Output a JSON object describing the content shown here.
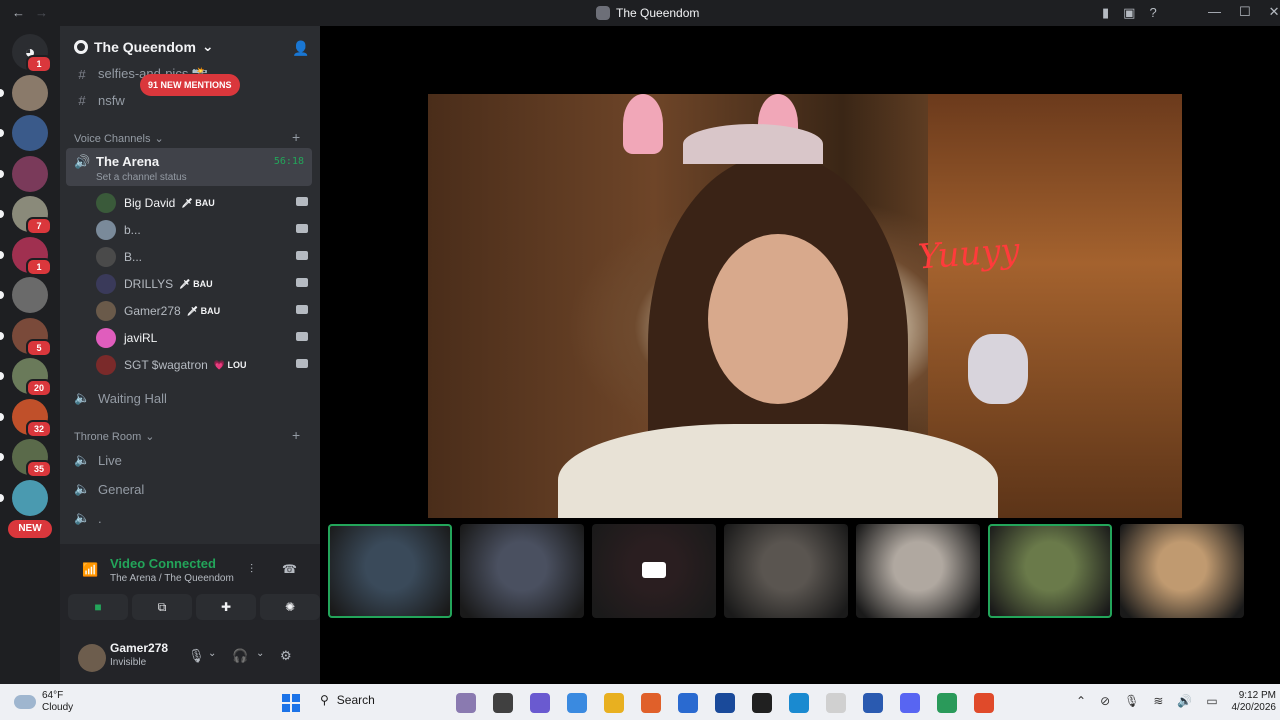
{
  "window": {
    "title": "The Queendom",
    "back": "←",
    "forward": "→",
    "minimize": "—",
    "maximize": "☐",
    "close": "✕"
  },
  "guilds": [
    {
      "name": "home",
      "badge": "1",
      "color": "#2b2d31"
    },
    {
      "badge": "",
      "color": "#8a7a6a"
    },
    {
      "badge": "",
      "color": "#3a5a8a"
    },
    {
      "badge": "",
      "color": "#7a3a5a"
    },
    {
      "badge": "7",
      "color": "#8a8a7a"
    },
    {
      "badge": "1",
      "color": "#a03050"
    },
    {
      "badge": "",
      "color": "#6a6a6a"
    },
    {
      "badge": "5",
      "color": "#7a4a3a"
    },
    {
      "badge": "20",
      "color": "#6a7a5a"
    },
    {
      "badge": "32",
      "color": "#c0502a"
    },
    {
      "badge": "35",
      "color": "#5a6a4a"
    },
    {
      "badge": "",
      "color": "#4a9ab0"
    }
  ],
  "new_pill": "NEW",
  "server": {
    "name": "The Queendom",
    "chevron": "⌄"
  },
  "channels_top": [
    {
      "icon": "#",
      "name": "selfies-and-pics 📸"
    },
    {
      "icon": "#",
      "name": "nsfw"
    }
  ],
  "mentions_pill": "91 NEW MENTIONS",
  "categories": {
    "voice": "Voice Channels",
    "throne": "Throne Room"
  },
  "arena": {
    "name": "The Arena",
    "status": "Set a channel status",
    "timer": "56:18"
  },
  "members": [
    {
      "name": "Big David",
      "tag": "🗡 BAU",
      "color": "#3a5a3a",
      "bold": true
    },
    {
      "name": "b...",
      "tag": "",
      "color": "#7a8a9a",
      "bold": false
    },
    {
      "name": "B...",
      "tag": "",
      "color": "#4a4a4a",
      "bold": false
    },
    {
      "name": "DRILLYS",
      "tag": "🗡 BAU",
      "color": "#3a3a5a",
      "bold": false
    },
    {
      "name": "Gamer278",
      "tag": "🗡 BAU",
      "color": "#6a5a4a",
      "bold": false
    },
    {
      "name": "javiRL",
      "tag": "",
      "color": "#e05dbd",
      "bold": true
    },
    {
      "name": "SGT $wagatron",
      "tag": "💗 LOU",
      "color": "#7a2a2a",
      "bold": false
    }
  ],
  "voice_channels_other": [
    {
      "name": "Waiting Hall"
    }
  ],
  "throne_channels": [
    {
      "name": "Live"
    },
    {
      "name": "General"
    },
    {
      "name": "."
    }
  ],
  "voice_panel": {
    "title": "Video Connected",
    "subtitle": "The Arena / The Queendom"
  },
  "user": {
    "name": "Gamer278",
    "status": "Invisible"
  },
  "main_video": {
    "neon_text": "Yuuyy"
  },
  "tiles": [
    {
      "color": "#3a4a5a",
      "speaking": true
    },
    {
      "color": "#4a5060",
      "speaking": false
    },
    {
      "color": "#2a1e20",
      "speaking": false,
      "camera_off": true
    },
    {
      "color": "#5a5550",
      "speaking": false
    },
    {
      "color": "#b0a8a0",
      "speaking": false
    },
    {
      "color": "#6a7a4a",
      "speaking": true
    },
    {
      "color": "#c09a70",
      "speaking": false
    }
  ],
  "taskbar": {
    "weather_temp": "64°F",
    "weather_desc": "Cloudy",
    "search": "Search",
    "time": "9:12 PM",
    "date": "4/20/2026",
    "apps": [
      "#8a7ab0",
      "#404040",
      "#6a5ad0",
      "#3a8ae0",
      "#e8b020",
      "#e0602a",
      "#2a6ad0",
      "#1a4a9a",
      "#202020",
      "#1a8ad0",
      "#d0d0d0",
      "#2a5ab0",
      "#5865f2",
      "#2a9a5a",
      "#e04a2a"
    ]
  }
}
